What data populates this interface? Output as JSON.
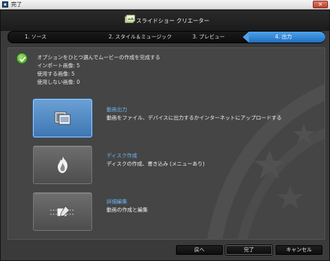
{
  "window": {
    "title": "完了",
    "close_label": "✕"
  },
  "header": {
    "app_title": "スライドショー クリエーター"
  },
  "steps": [
    {
      "label": "1. ソース"
    },
    {
      "label": "2. スタイル＆ミュージック"
    },
    {
      "label": "3. プレビュー"
    },
    {
      "label": "4. 出力"
    }
  ],
  "intro": {
    "line1": "オプションをひとつ選んでムービーの作成を完成する",
    "line2": "インポート画像: 5",
    "line3": "使用する画像: 5",
    "line4": "使用しない画像: 0"
  },
  "options": [
    {
      "title": "動画出力",
      "desc": "動画をファイル、デバイスに出力するかインターネットにアップロードする",
      "icon": "film-icon"
    },
    {
      "title": "ディスク作成",
      "desc": "ディスクの作成、書き込み (メニューあり)",
      "icon": "disc-burn-icon"
    },
    {
      "title": "詳細編集",
      "desc": "動画の作成と編集",
      "icon": "edit-timeline-icon"
    }
  ],
  "buttons": {
    "back": "戻へ",
    "finish": "完了",
    "cancel": "キャンセル"
  },
  "colors": {
    "accent": "#2f84d8",
    "link": "#6fb4f4",
    "check": "#3d9a1e"
  }
}
